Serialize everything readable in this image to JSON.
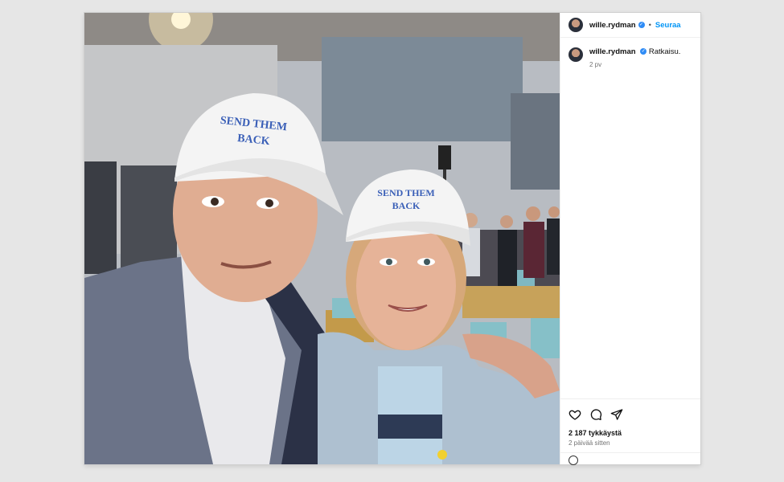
{
  "post": {
    "author": {
      "username": "wille.rydman",
      "verified": true
    },
    "follow_label": "Seuraa",
    "separator": "•",
    "caption": {
      "username": "wille.rydman",
      "text": "Ratkaisu.",
      "age": "2 pv"
    },
    "photo": {
      "cap_text_left": [
        "SEND THEM",
        "BACK"
      ],
      "cap_text_right": [
        "SEND THEM",
        "BACK"
      ]
    },
    "actions": {
      "icons": [
        "heart-icon",
        "comment-icon",
        "share-icon"
      ]
    },
    "likes": "2 187 tykkäystä",
    "date": "2 päivää sitten"
  },
  "colors": {
    "accent": "#0095f6",
    "verified": "#2f8cf6",
    "cap_text": "#3a5fb7"
  }
}
